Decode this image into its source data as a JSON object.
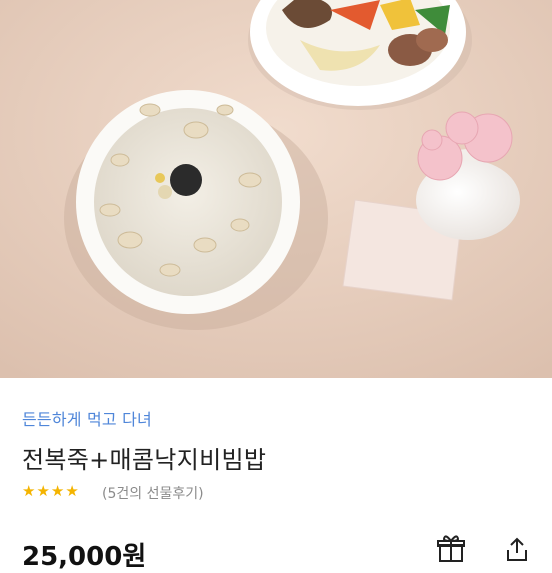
{
  "product": {
    "tagline": "든든하게 먹고 다녀",
    "name": "전복죽+매콤낙지비빔밥",
    "rating_stars": "★★★★",
    "review_text": "(5건의 선물후기)",
    "price": "25,000원"
  },
  "image": {
    "subject": "abalone porridge bowl and bibimbap plate with pink carnations",
    "background_color": "#e9d3c4"
  },
  "icons": {
    "gift": "gift-icon",
    "share": "share-icon"
  },
  "colors": {
    "tagline": "#4f86d9",
    "star": "#f4b400",
    "title": "#222222",
    "muted": "#8b8b8b"
  }
}
